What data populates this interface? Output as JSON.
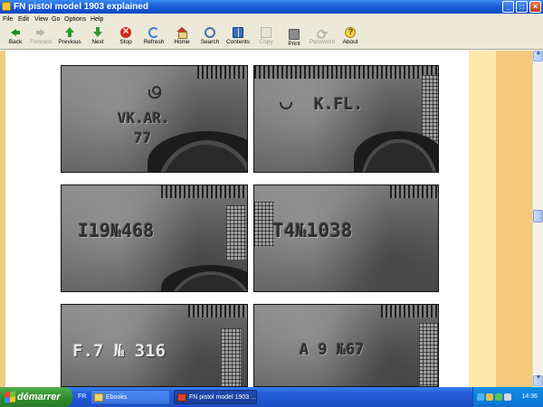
{
  "window": {
    "title": "FN pistol model 1903 explained",
    "minimize_glyph": "_",
    "maximize_glyph": "□",
    "close_glyph": "×"
  },
  "menu": [
    "File",
    "Edit",
    "View",
    "Go",
    "Options",
    "Help"
  ],
  "toolbar": [
    {
      "label": "Back",
      "icon": "back-arrow-icon",
      "enabled": true
    },
    {
      "label": "Forward",
      "icon": "forward-arrow-icon",
      "enabled": false
    },
    {
      "label": "Previous",
      "icon": "up-arrow-icon",
      "enabled": true
    },
    {
      "label": "Next",
      "icon": "down-arrow-icon",
      "enabled": true
    },
    {
      "label": "Stop",
      "icon": "stop-icon",
      "enabled": true
    },
    {
      "label": "Refresh",
      "icon": "refresh-icon",
      "enabled": true
    },
    {
      "label": "Home",
      "icon": "home-icon",
      "enabled": true
    },
    {
      "label": "Search",
      "icon": "search-icon",
      "enabled": true
    },
    {
      "label": "Contents",
      "icon": "contents-book-icon",
      "enabled": true
    },
    {
      "label": "Copy",
      "icon": "copy-icon",
      "enabled": false
    },
    {
      "label": "Print",
      "icon": "printer-icon",
      "enabled": true
    },
    {
      "label": "Password",
      "icon": "key-icon",
      "enabled": false
    },
    {
      "label": "About",
      "icon": "about-icon",
      "enabled": true
    }
  ],
  "photos": [
    {
      "stamp_line1": "VK.AR.",
      "stamp_line2": "77",
      "mark": "crown-icon"
    },
    {
      "stamp_line1": "K.FL.",
      "stamp_line2": "",
      "mark": "proof-mark-icon"
    },
    {
      "stamp_line1": "I19№468",
      "stamp_line2": ""
    },
    {
      "stamp_line1": "T4№1038",
      "stamp_line2": ""
    },
    {
      "stamp_line1": "F.7 № 316",
      "stamp_line2": ""
    },
    {
      "stamp_line1": "A 9 №67",
      "stamp_line2": ""
    }
  ],
  "taskbar": {
    "start_label": "démarrer",
    "language": "FR",
    "tasks": [
      {
        "label": "Ebooks",
        "icon": "folder-icon",
        "active": false
      },
      {
        "label": "FN pistol model 1903 ...",
        "icon": "ebook-icon",
        "active": true
      }
    ],
    "clock": "14:36"
  },
  "colors": {
    "titlebar": "#0a46c4",
    "chrome": "#ece9d8",
    "side_strip": "#f5c87c",
    "side_pale": "#fde9ab",
    "taskbar": "#245edb",
    "start_button": "#2e8a2b"
  }
}
